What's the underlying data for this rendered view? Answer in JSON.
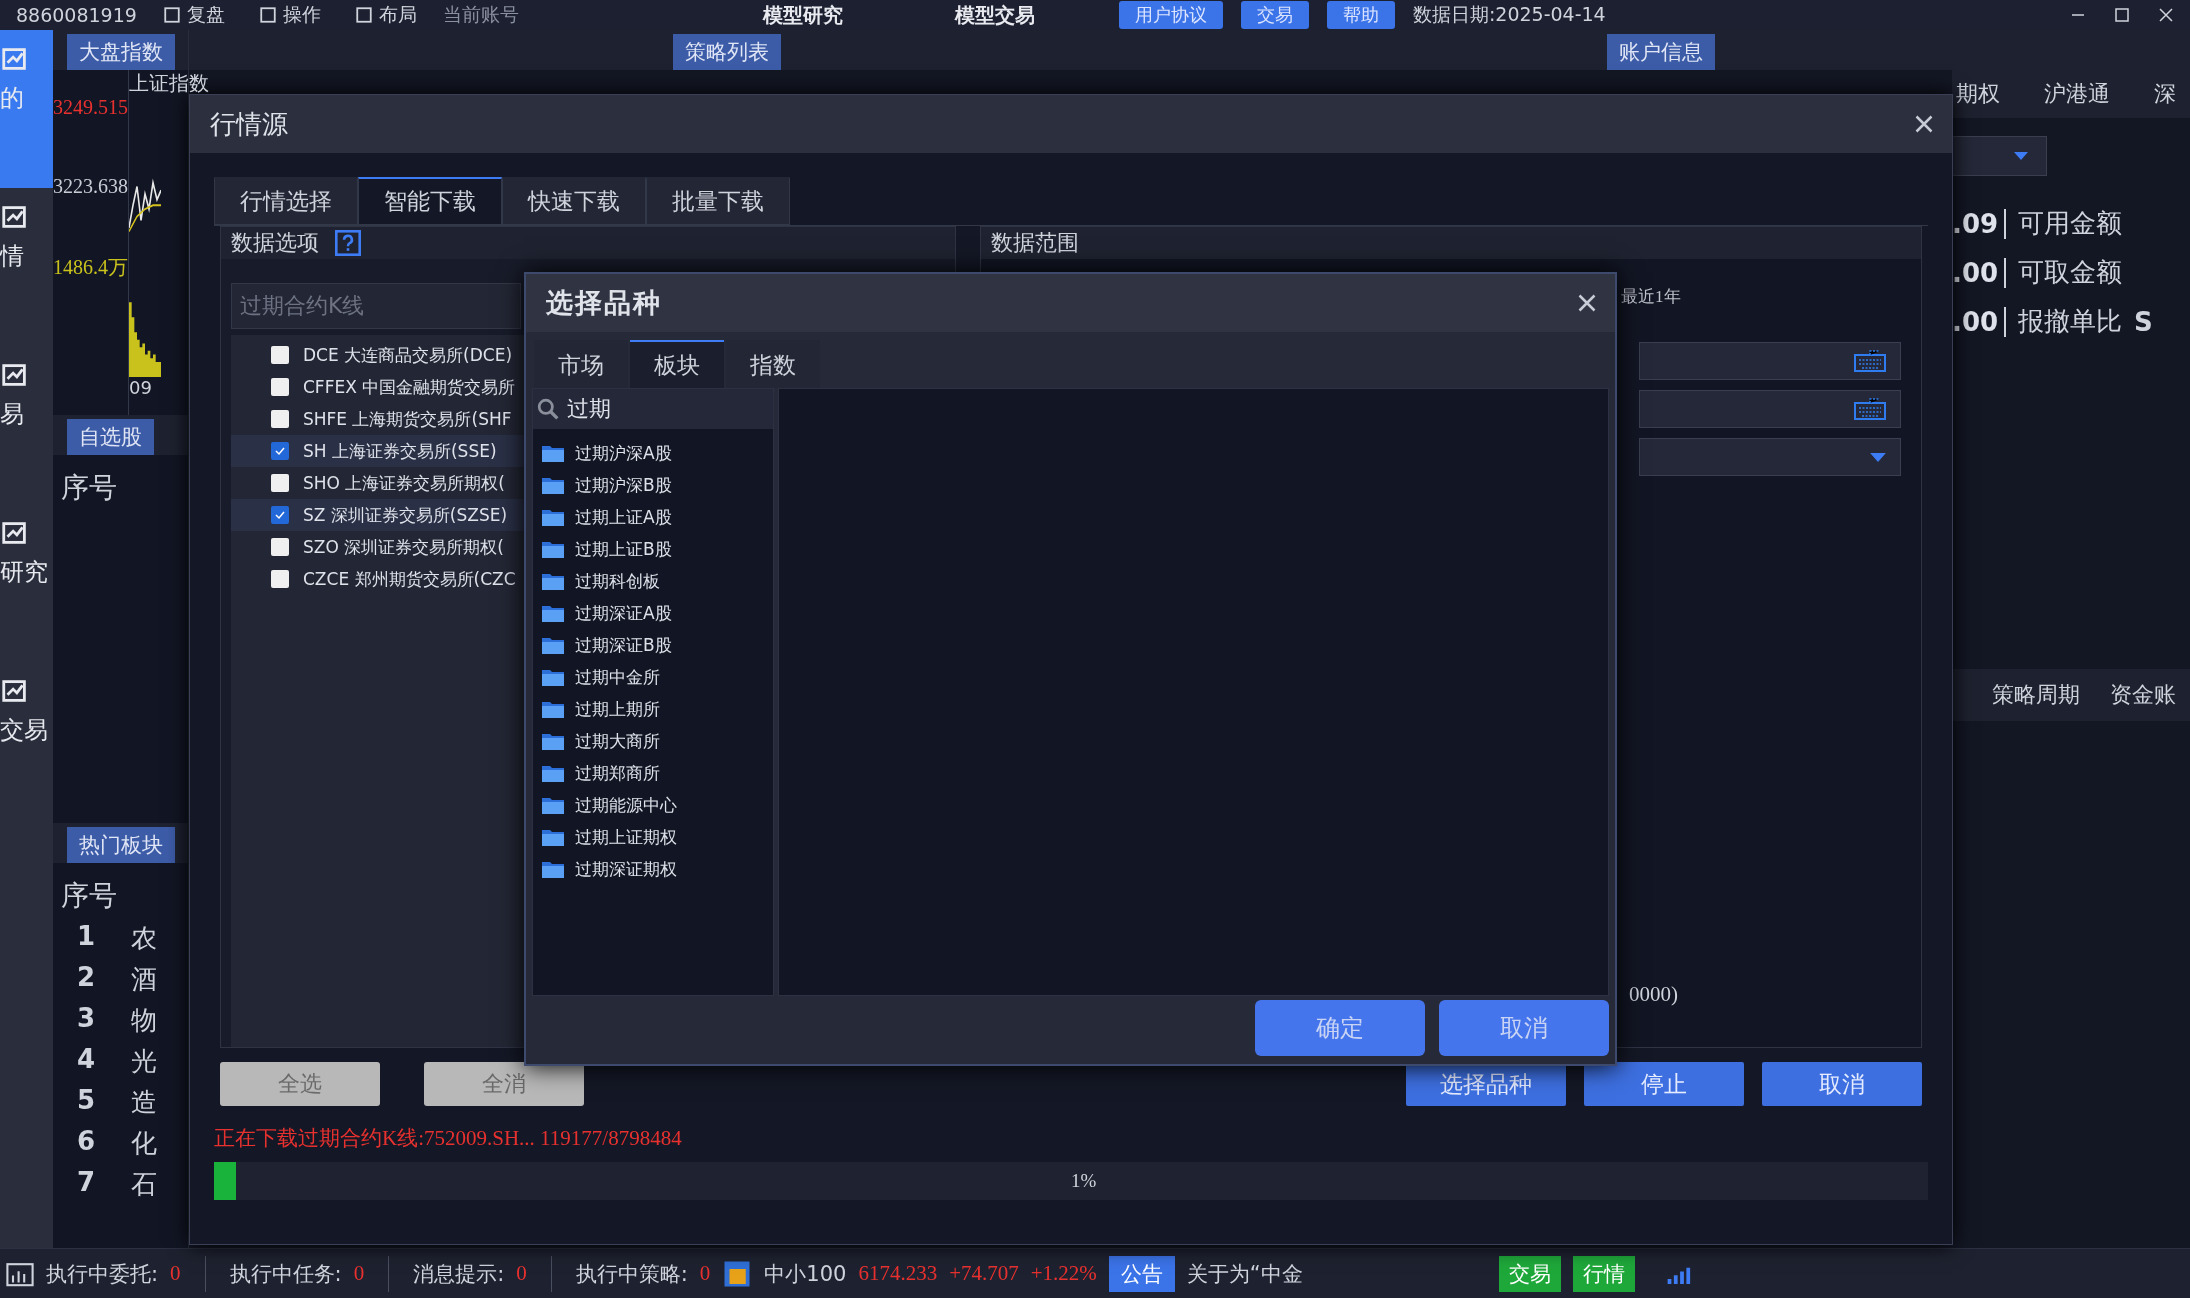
{
  "top_bar": {
    "account_id": "8860081919",
    "menu": [
      "复盘",
      "操作",
      "布局"
    ],
    "account_label": "当前账号",
    "modes": [
      "模型研究",
      "模型交易"
    ],
    "buttons": [
      "用户协议",
      "交易",
      "帮助"
    ],
    "data_date": "数据日期:2025-04-14"
  },
  "rail": [
    {
      "label": "的",
      "selected": true
    },
    {
      "label": "情",
      "selected": false
    },
    {
      "label": "易",
      "selected": false
    },
    {
      "label": "研究",
      "selected": false
    },
    {
      "label": "交易",
      "selected": false
    }
  ],
  "index_panel": {
    "title": "大盘指数",
    "name": "上证指数",
    "prices": [
      {
        "text": "3249.515",
        "color": "#e8312f"
      },
      {
        "text": "3223.638",
        "color": "#c8ccd6"
      },
      {
        "text": "1486.4万",
        "color": "#c9c21c"
      }
    ],
    "time": "09"
  },
  "watchlist": {
    "title": "自选股",
    "column": "序号"
  },
  "hot_sectors": {
    "title": "热门板块",
    "column": "序号",
    "rows": [
      {
        "rank": "1",
        "name": "农"
      },
      {
        "rank": "2",
        "name": "酒"
      },
      {
        "rank": "3",
        "name": "物"
      },
      {
        "rank": "4",
        "name": "光"
      },
      {
        "rank": "5",
        "name": "造"
      },
      {
        "rank": "6",
        "name": "化"
      },
      {
        "rank": "7",
        "name": "石"
      }
    ]
  },
  "panel_headers": [
    "策略列表",
    "账户信息"
  ],
  "account": {
    "tabs": [
      "期权",
      "沪港通",
      "深"
    ],
    "rows": [
      {
        "value": ".09",
        "label": "可用金额"
      },
      {
        "value": ".00",
        "label": "可取金额"
      },
      {
        "value": ".00",
        "label": "报撤单比"
      }
    ],
    "extra": "S",
    "columns": [
      "策略周期",
      "资金账"
    ]
  },
  "dialog": {
    "title": "行情源",
    "tabs": [
      {
        "label": "行情选择",
        "selected": false
      },
      {
        "label": "智能下载",
        "selected": true
      },
      {
        "label": "快速下载",
        "selected": false
      },
      {
        "label": "批量下载",
        "selected": false
      }
    ],
    "options": {
      "title": "数据选项",
      "field": "过期合约K线",
      "markets": [
        {
          "label": "DCE 大连商品交易所(DCE)",
          "checked": false
        },
        {
          "label": "CFFEX 中国金融期货交易所",
          "checked": false
        },
        {
          "label": "SHFE 上海期货交易所(SHF",
          "checked": false
        },
        {
          "label": "SH 上海证券交易所(SSE)",
          "checked": true
        },
        {
          "label": "SHO 上海证券交易所期权(",
          "checked": false
        },
        {
          "label": "SZ 深圳证券交易所(SZSE)",
          "checked": true
        },
        {
          "label": "SZO 深圳证券交易所期权(",
          "checked": false
        },
        {
          "label": "CZCE 郑州期货交易所(CZC",
          "checked": false
        }
      ]
    },
    "range": {
      "title": "数据范围",
      "period": "最近1年",
      "note": "0000)"
    },
    "left_buttons": [
      {
        "label": "全选",
        "disabled": true
      },
      {
        "label": "全消",
        "disabled": true
      }
    ],
    "right_buttons": [
      "选择品种",
      "停止",
      "取消"
    ],
    "status": "正在下载过期合约K线:752009.SH... 119177/8798484",
    "progress": {
      "level": 0.013,
      "reading": "1%"
    }
  },
  "picker": {
    "title": "选择品种",
    "tabs": [
      {
        "label": "市场",
        "selected": false
      },
      {
        "label": "板块",
        "selected": true
      },
      {
        "label": "指数",
        "selected": false
      }
    ],
    "search": {
      "value": "过期"
    },
    "items": [
      "过期沪深A股",
      "过期沪深B股",
      "过期上证A股",
      "过期上证B股",
      "过期科创板",
      "过期深证A股",
      "过期深证B股",
      "过期中金所",
      "过期上期所",
      "过期大商所",
      "过期郑商所",
      "过期能源中心",
      "过期上证期权",
      "过期深证期权"
    ],
    "buttons": [
      "确定",
      "取消"
    ]
  },
  "status_bar": {
    "counters": [
      {
        "label": "执行中委托:",
        "value": "0"
      },
      {
        "label": "执行中任务:",
        "value": "0"
      },
      {
        "label": "消息提示:",
        "value": "0"
      },
      {
        "label": "执行中策略:",
        "value": "0"
      }
    ],
    "index": {
      "name": "中小100",
      "price": "6174.233",
      "change": "+74.707",
      "percent": "+1.22%"
    },
    "notice_label": "公告",
    "notice": "关于为“中金",
    "buttons": [
      "交易",
      "行情"
    ]
  }
}
